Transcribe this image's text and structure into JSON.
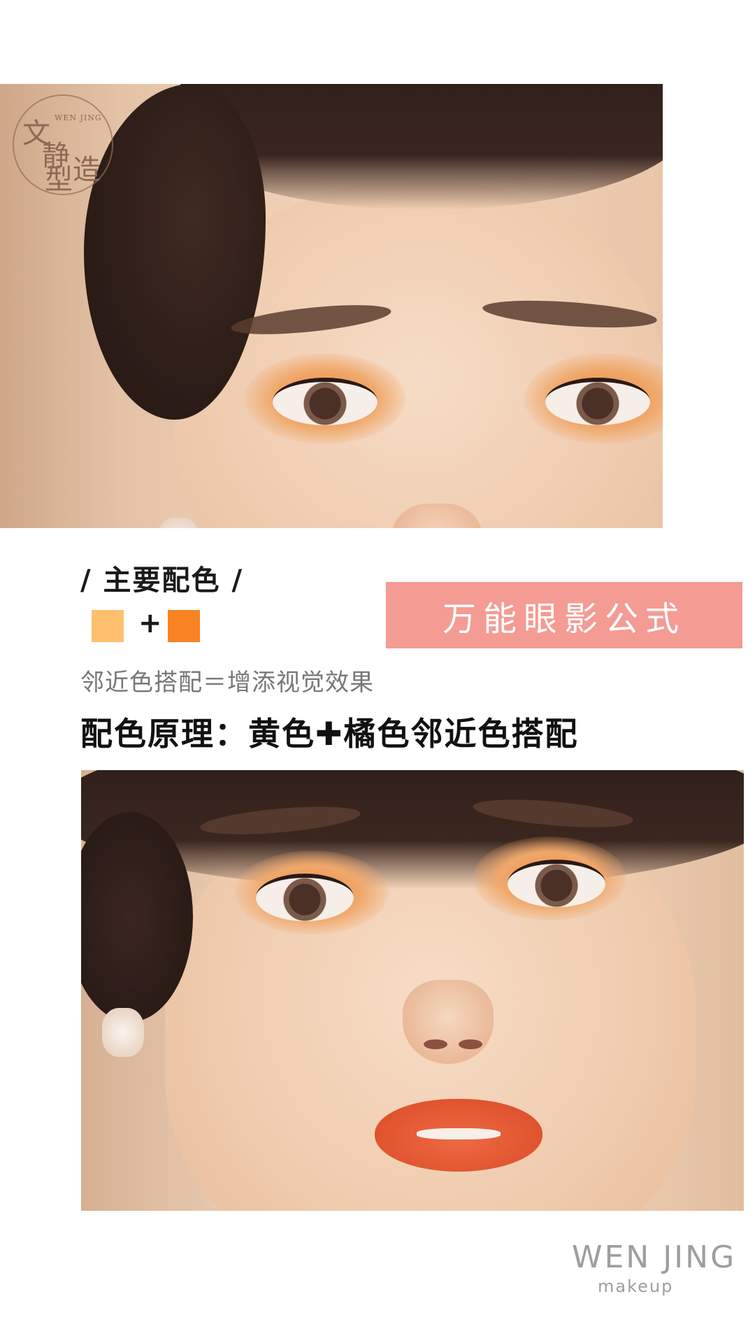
{
  "logo": {
    "text_cn": "文静造型",
    "text_en": "WEN JING"
  },
  "section_title": "/ 主要配色 /",
  "palette": {
    "colors": [
      "#fec06f",
      "#f98323"
    ],
    "joiner": "+"
  },
  "banner": {
    "text": "万能眼影公式",
    "color": "#f49b94"
  },
  "note": "邻近色搭配＝增添视觉效果",
  "principle": "配色原理：黄色✚橘色邻近色搭配",
  "brand": {
    "name": "WEN JING",
    "sub": "makeup"
  }
}
